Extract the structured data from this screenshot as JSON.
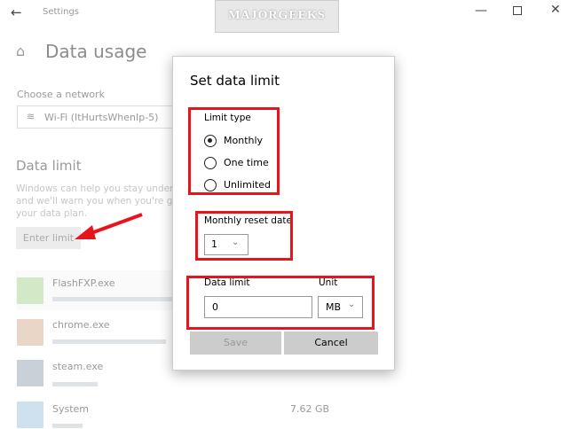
{
  "window": {
    "title": "Settings",
    "watermark": "MAJORGEEKS .COM"
  },
  "page": {
    "title": "Data usage",
    "network_label": "Choose a network",
    "network_value": "Wi-Fi (ItHurtsWhenIp-5)",
    "section": "Data limit",
    "description_lines": [
      "Windows can help you stay under yo",
      "and we'll warn you when you're gett",
      "your data plan."
    ],
    "enter_limit": "Enter limit"
  },
  "apps": [
    {
      "name": "FlashFXP.exe",
      "usage": ""
    },
    {
      "name": "chrome.exe",
      "usage": ""
    },
    {
      "name": "steam.exe",
      "usage": ""
    },
    {
      "name": "System",
      "usage": "7.62 GB"
    }
  ],
  "dialog": {
    "title": "Set data limit",
    "limit_type_label": "Limit type",
    "limit_types": [
      "Monthly",
      "One time",
      "Unlimited"
    ],
    "selected": "Monthly",
    "reset_label": "Monthly reset date",
    "reset_value": "1",
    "data_limit_label": "Data limit",
    "data_limit_value": "0",
    "unit_label": "Unit",
    "unit_value": "MB",
    "save": "Save",
    "cancel": "Cancel"
  },
  "colors": {
    "highlight": "#e8141b"
  }
}
